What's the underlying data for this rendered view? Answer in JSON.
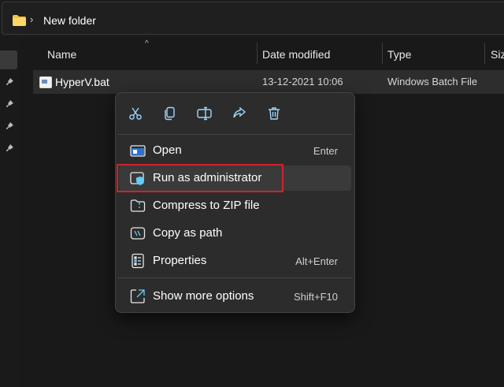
{
  "address_bar": {
    "breadcrumb_separator": "›",
    "current_folder": "New folder",
    "icon": "folder-icon"
  },
  "nav_pane": {
    "pin_icons": [
      "pin-icon",
      "pin-icon",
      "pin-icon",
      "pin-icon"
    ]
  },
  "columns": {
    "name": "Name",
    "date_modified": "Date modified",
    "type": "Type",
    "size": "Size"
  },
  "file": {
    "name": "HyperV.bat",
    "date_modified": "13-12-2021 10:06",
    "type": "Windows Batch File",
    "icon": "batch-file-icon"
  },
  "context_menu": {
    "command_bar": [
      "cut-icon",
      "copy-icon",
      "rename-icon",
      "share-icon",
      "delete-icon"
    ],
    "items": [
      {
        "label": "Open",
        "shortcut": "Enter",
        "icon": "open-icon"
      },
      {
        "label": "Run as administrator",
        "shortcut": "",
        "icon": "shield-icon"
      },
      {
        "label": "Compress to ZIP file",
        "shortcut": "",
        "icon": "zip-icon"
      },
      {
        "label": "Copy as path",
        "shortcut": "",
        "icon": "copy-path-icon"
      },
      {
        "label": "Properties",
        "shortcut": "Alt+Enter",
        "icon": "properties-icon"
      },
      {
        "label": "Show more options",
        "shortcut": "Shift+F10",
        "icon": "more-options-icon"
      }
    ]
  },
  "colors": {
    "accent": "#60cdff",
    "highlight_border": "#d3222b",
    "folder": "#f5c542"
  }
}
